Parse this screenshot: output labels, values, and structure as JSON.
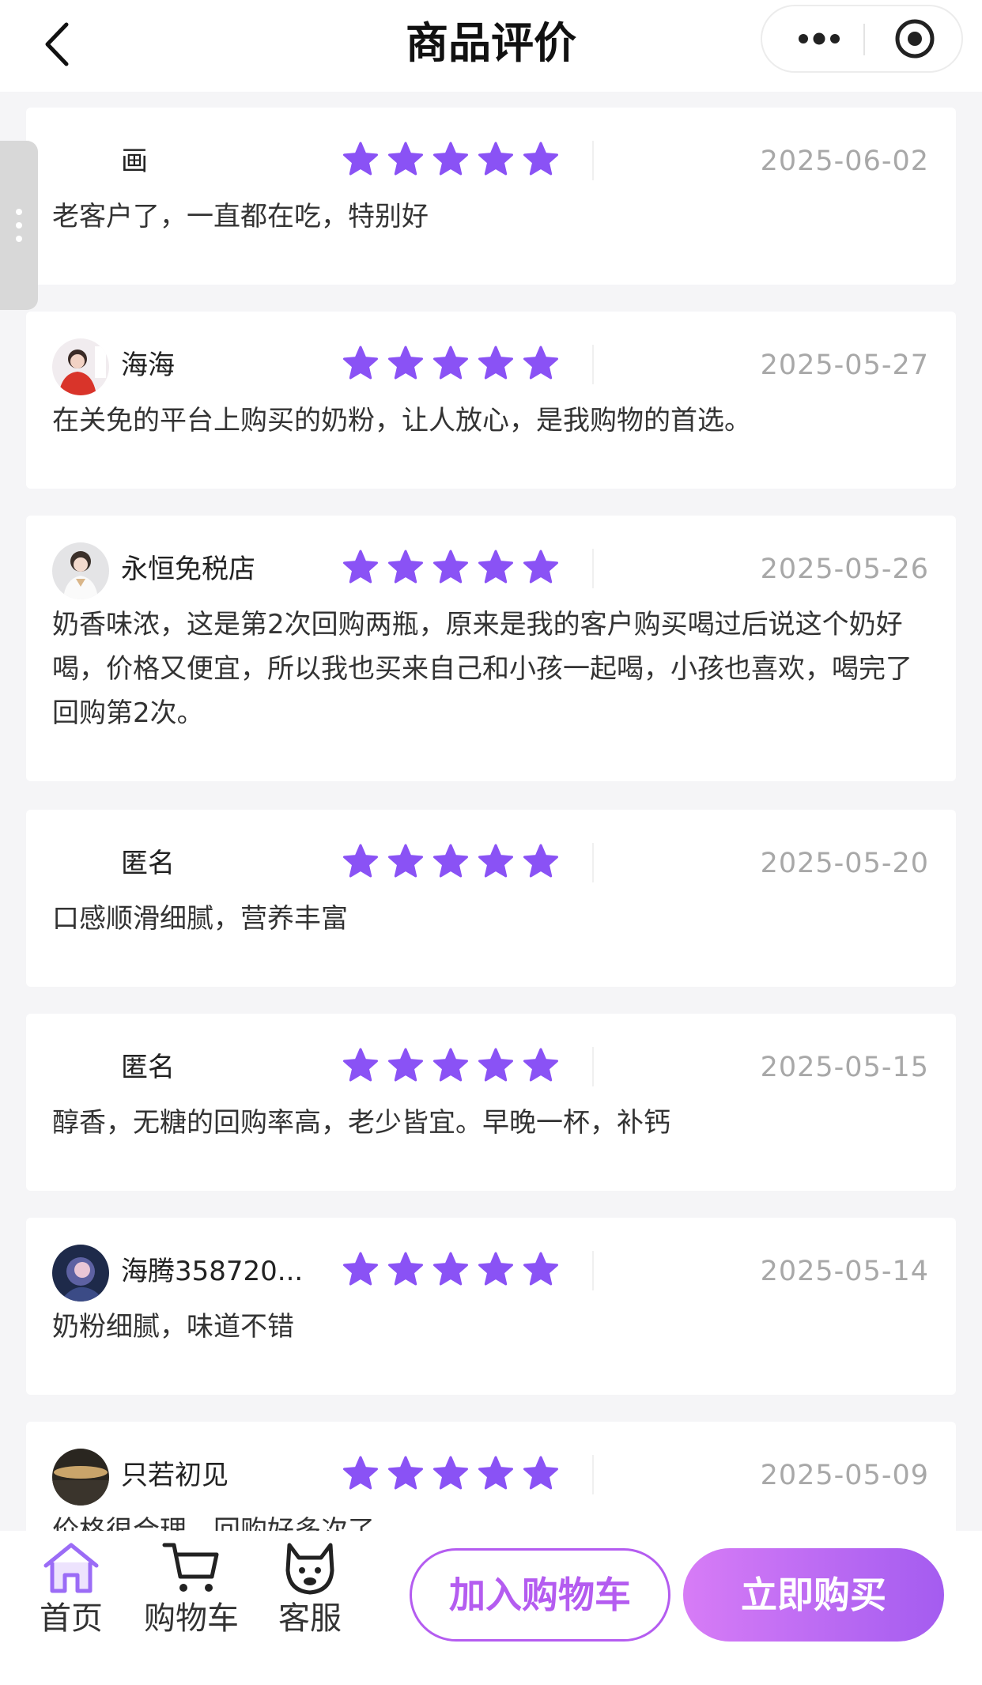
{
  "header": {
    "title": "商品评价"
  },
  "colors": {
    "star": "#8a52f5",
    "accent": "#b45cf0"
  },
  "reviews": [
    {
      "user": "画",
      "has_avatar": false,
      "date": "2025-06-02",
      "content": "老客户了，一直都在吃，特别好",
      "rating": 5
    },
    {
      "user": "海海",
      "has_avatar": true,
      "date": "2025-05-27",
      "content": "在关免的平台上购买的奶粉，让人放心，是我购物的首选。",
      "rating": 5
    },
    {
      "user": "永恒免税店",
      "has_avatar": true,
      "date": "2025-05-26",
      "content": "奶香味浓，这是第2次回购两瓶，原来是我的客户购买喝过后说这个奶好喝，价格又便宜，所以我也买来自己和小孩一起喝，小孩也喜欢，喝完了回购第2次。",
      "rating": 5
    },
    {
      "user": "匿名",
      "has_avatar": false,
      "date": "2025-05-20",
      "content": "口感顺滑细腻，营养丰富",
      "rating": 5
    },
    {
      "user": "匿名",
      "has_avatar": false,
      "date": "2025-05-15",
      "content": "醇香，无糖的回购率高，老少皆宜。早晚一杯，补钙",
      "rating": 5
    },
    {
      "user": "海腾358720...",
      "has_avatar": true,
      "date": "2025-05-14",
      "content": "奶粉细腻，味道不错",
      "rating": 5
    },
    {
      "user": "只若初见",
      "has_avatar": true,
      "date": "2025-05-09",
      "content": "价格很合理，回购好多次了",
      "rating": 5
    }
  ],
  "bottom_bar": {
    "home": "首页",
    "cart": "购物车",
    "service": "客服",
    "add_to_cart": "加入购物车",
    "buy_now": "立即购买"
  }
}
